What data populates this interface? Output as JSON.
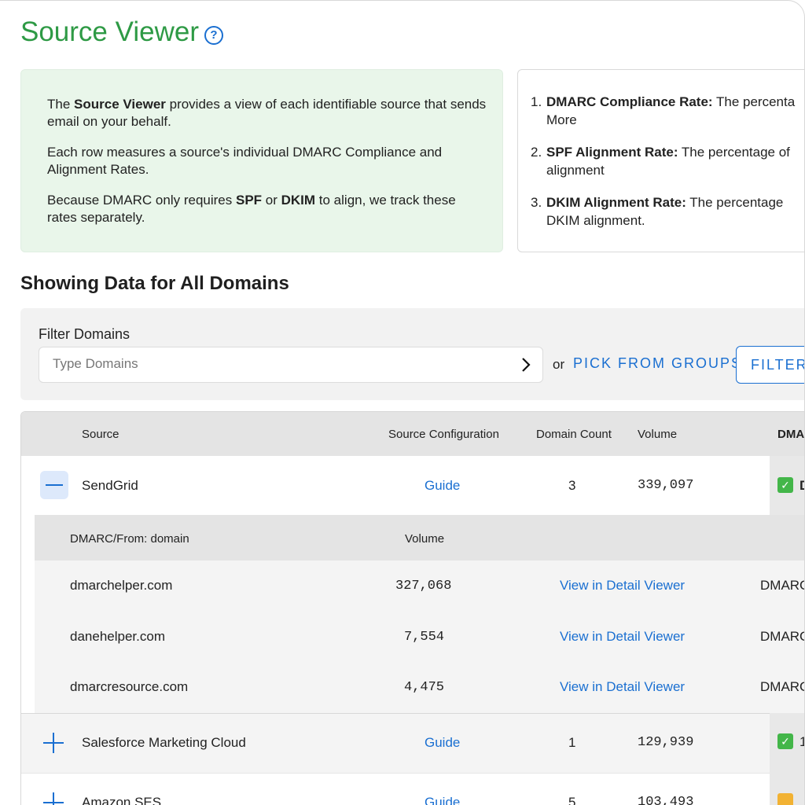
{
  "page": {
    "title": "Source Viewer",
    "help_icon": "question-circle-icon",
    "accent": "#2e9a45",
    "link_color": "#1a6fd1"
  },
  "intro": {
    "p1_a": "The ",
    "p1_b": "Source Viewer",
    "p1_c": " provides a view of each identifiable source that sends email on your behalf.",
    "p2": "Each row measures a source's individual DMARC Compliance and Alignment Rates.",
    "p3_a": "Because DMARC only requires ",
    "p3_b": "SPF",
    "p3_c": " or ",
    "p3_d": "DKIM",
    "p3_e": " to align, we track these rates separately."
  },
  "definitions": [
    {
      "num": "1.",
      "term": "DMARC Compliance Rate:",
      "text": " The percenta",
      "more": "More"
    },
    {
      "num": "2.",
      "term": "SPF Alignment Rate:",
      "text": " The percentage of",
      "line2": "alignment"
    },
    {
      "num": "3.",
      "term": "DKIM Alignment Rate:",
      "text": " The percentage",
      "line2": "DKIM alignment."
    }
  ],
  "section_heading": "Showing Data for All Domains",
  "filter": {
    "label": "Filter Domains",
    "placeholder": "Type Domains",
    "value": "",
    "or": "or",
    "pick_from_groups": "PICK FROM GROUPS",
    "filter_button": "FILTER"
  },
  "table": {
    "headers": {
      "source": "Source",
      "config": "Source Configuration",
      "domain_count": "Domain Count",
      "volume": "Volume",
      "dmarc": "DMAI"
    },
    "rows": [
      {
        "name": "SendGrid",
        "guide": "Guide",
        "domain_count": "3",
        "volume": "339,097",
        "status": "check",
        "status_text": "D",
        "expanded": true
      },
      {
        "name": "Salesforce Marketing Cloud",
        "guide": "Guide",
        "domain_count": "1",
        "volume": "129,939",
        "status": "check",
        "status_text": "1",
        "expanded": false
      },
      {
        "name": "Amazon SES",
        "guide": "Guide",
        "domain_count": "5",
        "volume": "103,493",
        "status": "warn",
        "status_text": "",
        "expanded": false
      }
    ],
    "sub": {
      "headers": {
        "domain": "DMARC/From: domain",
        "volume": "Volume"
      },
      "rows": [
        {
          "domain": "dmarchelper.com",
          "volume": "327,068",
          "link": "View in Detail Viewer",
          "tail": "DMARC"
        },
        {
          "domain": "danehelper.com",
          "volume": "7,554",
          "link": "View in Detail Viewer",
          "tail": "DMARC"
        },
        {
          "domain": "dmarcresource.com",
          "volume": "4,475",
          "link": "View in Detail Viewer",
          "tail": "DMARC"
        }
      ]
    }
  }
}
